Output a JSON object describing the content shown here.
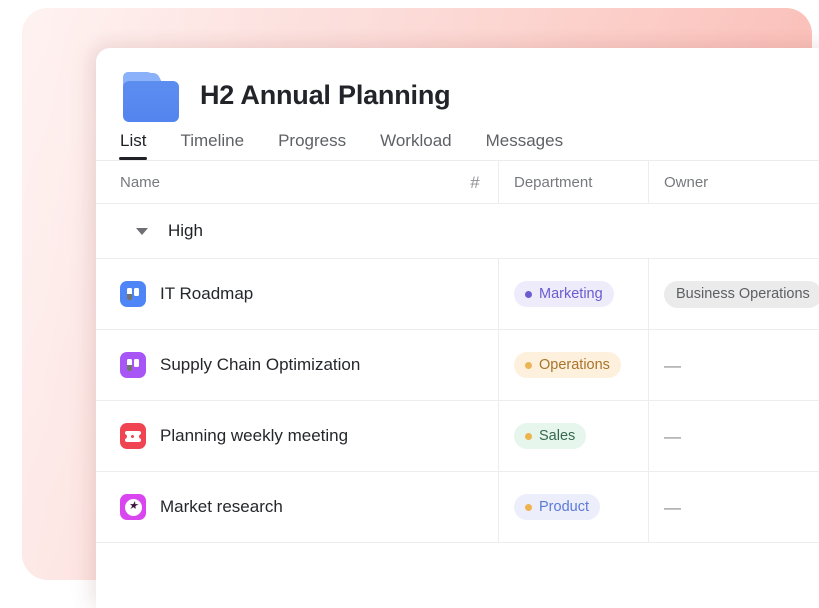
{
  "header": {
    "title": "H2 Annual Planning",
    "folder_icon": "folder-icon"
  },
  "tabs": [
    {
      "label": "List",
      "active": true
    },
    {
      "label": "Timeline",
      "active": false
    },
    {
      "label": "Progress",
      "active": false
    },
    {
      "label": "Workload",
      "active": false
    },
    {
      "label": "Messages",
      "active": false
    }
  ],
  "table": {
    "columns": {
      "name": "Name",
      "hash": "#",
      "department": "Department",
      "owner": "Owner"
    },
    "group": {
      "label": "High",
      "expanded": true
    },
    "rows": [
      {
        "icon": "board-icon",
        "icon_color": "#4f86f7",
        "name": "IT Roadmap",
        "department": "Marketing",
        "dept_bg": "#eeecfb",
        "dept_text": "#6b5cd1",
        "dept_dot": "#6b5cd1",
        "owner": "Business Operations",
        "owner_type": "pill"
      },
      {
        "icon": "board-icon",
        "icon_color": "#a855f7",
        "name": "Supply Chain Optimization",
        "department": "Operations",
        "dept_bg": "#fdf0dd",
        "dept_text": "#a9742a",
        "dept_dot": "#eab555",
        "owner": "—",
        "owner_type": "empty"
      },
      {
        "icon": "ticket-icon",
        "icon_color": "#f04452",
        "name": "Planning weekly meeting",
        "department": "Sales",
        "dept_bg": "#e6f6ec",
        "dept_text": "#36694f",
        "dept_dot": "#eeb24f",
        "owner": "—",
        "owner_type": "empty"
      },
      {
        "icon": "star-icon",
        "icon_color": "#d946ef",
        "name": "Market research",
        "department": "Product",
        "dept_bg": "#eceefb",
        "dept_text": "#5b7ad6",
        "dept_dot": "#eeb24f",
        "owner": "—",
        "owner_type": "empty"
      }
    ]
  },
  "theme": {
    "backdrop_start": "#fde3e0",
    "backdrop_end": "#fbb9b2",
    "card_bg": "#ffffff",
    "accent_text": "#1f2126"
  }
}
